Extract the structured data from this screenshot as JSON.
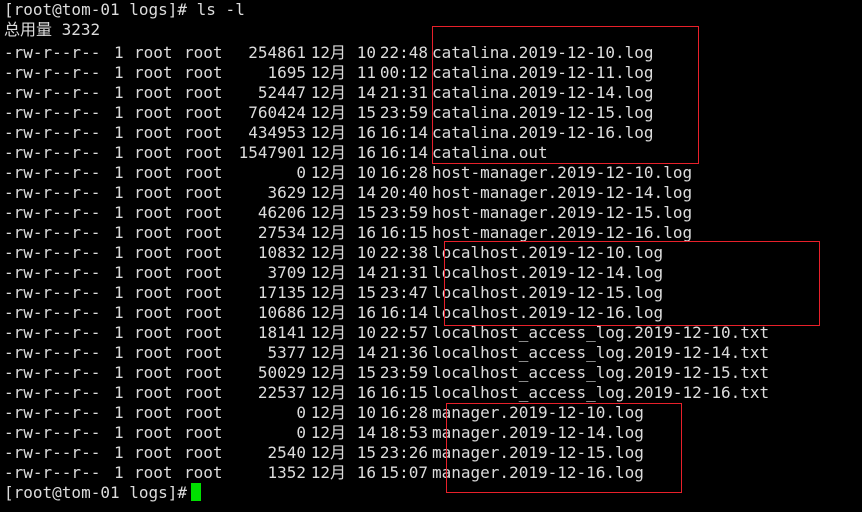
{
  "terminal": {
    "prompt_top": "[root@tom-01 logs]# ls -l",
    "total_line": "总用量 3232",
    "prompt_bottom": "[root@tom-01 logs]#",
    "cursor_color": "#00e000",
    "highlight_color": "#e8202a",
    "listing": [
      {
        "perm": "-rw-r--r--",
        "links": "1",
        "owner": "root",
        "group": "root",
        "size": "254861",
        "month": "12月",
        "day": "10",
        "time": "22:48",
        "name": "catalina.2019-12-10.log"
      },
      {
        "perm": "-rw-r--r--",
        "links": "1",
        "owner": "root",
        "group": "root",
        "size": "1695",
        "month": "12月",
        "day": "11",
        "time": "00:12",
        "name": "catalina.2019-12-11.log"
      },
      {
        "perm": "-rw-r--r--",
        "links": "1",
        "owner": "root",
        "group": "root",
        "size": "52447",
        "month": "12月",
        "day": "14",
        "time": "21:31",
        "name": "catalina.2019-12-14.log"
      },
      {
        "perm": "-rw-r--r--",
        "links": "1",
        "owner": "root",
        "group": "root",
        "size": "760424",
        "month": "12月",
        "day": "15",
        "time": "23:59",
        "name": "catalina.2019-12-15.log"
      },
      {
        "perm": "-rw-r--r--",
        "links": "1",
        "owner": "root",
        "group": "root",
        "size": "434953",
        "month": "12月",
        "day": "16",
        "time": "16:14",
        "name": "catalina.2019-12-16.log"
      },
      {
        "perm": "-rw-r--r--",
        "links": "1",
        "owner": "root",
        "group": "root",
        "size": "1547901",
        "month": "12月",
        "day": "16",
        "time": "16:14",
        "name": "catalina.out"
      },
      {
        "perm": "-rw-r--r--",
        "links": "1",
        "owner": "root",
        "group": "root",
        "size": "0",
        "month": "12月",
        "day": "10",
        "time": "16:28",
        "name": "host-manager.2019-12-10.log"
      },
      {
        "perm": "-rw-r--r--",
        "links": "1",
        "owner": "root",
        "group": "root",
        "size": "3629",
        "month": "12月",
        "day": "14",
        "time": "20:40",
        "name": "host-manager.2019-12-14.log"
      },
      {
        "perm": "-rw-r--r--",
        "links": "1",
        "owner": "root",
        "group": "root",
        "size": "46206",
        "month": "12月",
        "day": "15",
        "time": "23:59",
        "name": "host-manager.2019-12-15.log"
      },
      {
        "perm": "-rw-r--r--",
        "links": "1",
        "owner": "root",
        "group": "root",
        "size": "27534",
        "month": "12月",
        "day": "16",
        "time": "16:15",
        "name": "host-manager.2019-12-16.log"
      },
      {
        "perm": "-rw-r--r--",
        "links": "1",
        "owner": "root",
        "group": "root",
        "size": "10832",
        "month": "12月",
        "day": "10",
        "time": "22:38",
        "name": "localhost.2019-12-10.log"
      },
      {
        "perm": "-rw-r--r--",
        "links": "1",
        "owner": "root",
        "group": "root",
        "size": "3709",
        "month": "12月",
        "day": "14",
        "time": "21:31",
        "name": "localhost.2019-12-14.log"
      },
      {
        "perm": "-rw-r--r--",
        "links": "1",
        "owner": "root",
        "group": "root",
        "size": "17135",
        "month": "12月",
        "day": "15",
        "time": "23:47",
        "name": "localhost.2019-12-15.log"
      },
      {
        "perm": "-rw-r--r--",
        "links": "1",
        "owner": "root",
        "group": "root",
        "size": "10686",
        "month": "12月",
        "day": "16",
        "time": "16:14",
        "name": "localhost.2019-12-16.log"
      },
      {
        "perm": "-rw-r--r--",
        "links": "1",
        "owner": "root",
        "group": "root",
        "size": "18141",
        "month": "12月",
        "day": "10",
        "time": "22:57",
        "name": "localhost_access_log.2019-12-10.txt"
      },
      {
        "perm": "-rw-r--r--",
        "links": "1",
        "owner": "root",
        "group": "root",
        "size": "5377",
        "month": "12月",
        "day": "14",
        "time": "21:36",
        "name": "localhost_access_log.2019-12-14.txt"
      },
      {
        "perm": "-rw-r--r--",
        "links": "1",
        "owner": "root",
        "group": "root",
        "size": "50029",
        "month": "12月",
        "day": "15",
        "time": "23:59",
        "name": "localhost_access_log.2019-12-15.txt"
      },
      {
        "perm": "-rw-r--r--",
        "links": "1",
        "owner": "root",
        "group": "root",
        "size": "22537",
        "month": "12月",
        "day": "16",
        "time": "16:15",
        "name": "localhost_access_log.2019-12-16.txt"
      },
      {
        "perm": "-rw-r--r--",
        "links": "1",
        "owner": "root",
        "group": "root",
        "size": "0",
        "month": "12月",
        "day": "10",
        "time": "16:28",
        "name": "manager.2019-12-10.log"
      },
      {
        "perm": "-rw-r--r--",
        "links": "1",
        "owner": "root",
        "group": "root",
        "size": "0",
        "month": "12月",
        "day": "14",
        "time": "18:53",
        "name": "manager.2019-12-14.log"
      },
      {
        "perm": "-rw-r--r--",
        "links": "1",
        "owner": "root",
        "group": "root",
        "size": "2540",
        "month": "12月",
        "day": "15",
        "time": "23:26",
        "name": "manager.2019-12-15.log"
      },
      {
        "perm": "-rw-r--r--",
        "links": "1",
        "owner": "root",
        "group": "root",
        "size": "1352",
        "month": "12月",
        "day": "16",
        "time": "15:07",
        "name": "manager.2019-12-16.log"
      }
    ]
  }
}
